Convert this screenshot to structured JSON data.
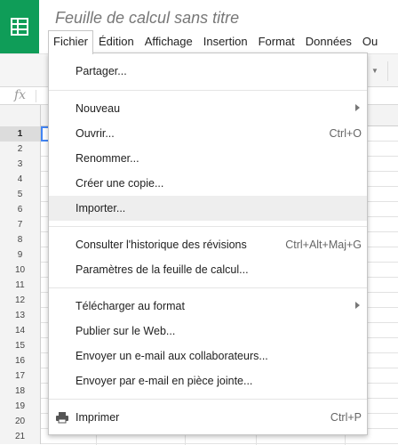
{
  "header": {
    "doc_title": "Feuille de calcul sans titre",
    "app_icon": "sheets-icon"
  },
  "menubar": [
    {
      "label": "Fichier",
      "active": true
    },
    {
      "label": "Édition"
    },
    {
      "label": "Affichage"
    },
    {
      "label": "Insertion"
    },
    {
      "label": "Format"
    },
    {
      "label": "Données"
    },
    {
      "label": "Ou"
    }
  ],
  "formula_bar": {
    "fx_label": "fx"
  },
  "grid": {
    "row_numbers": [
      "1",
      "2",
      "3",
      "4",
      "5",
      "6",
      "7",
      "8",
      "9",
      "10",
      "11",
      "12",
      "13",
      "14",
      "15",
      "16",
      "17",
      "18",
      "19",
      "20",
      "21"
    ],
    "selected_row": "1"
  },
  "file_menu": {
    "share": "Partager...",
    "new": "Nouveau",
    "open": "Ouvrir...",
    "open_shortcut": "Ctrl+O",
    "rename": "Renommer...",
    "copy": "Créer une copie...",
    "import": "Importer...",
    "history": "Consulter l'historique des révisions",
    "history_shortcut": "Ctrl+Alt+Maj+G",
    "settings": "Paramètres de la feuille de calcul...",
    "download": "Télécharger au format",
    "publish": "Publier sur le Web...",
    "email_collab": "Envoyer un e-mail aux collaborateurs...",
    "email_attach": "Envoyer par e-mail en pièce jointe...",
    "print": "Imprimer",
    "print_shortcut": "Ctrl+P",
    "print_icon": "printer-icon"
  },
  "colors": {
    "brand_green": "#0f9d58",
    "selection_blue": "#4285f4"
  }
}
